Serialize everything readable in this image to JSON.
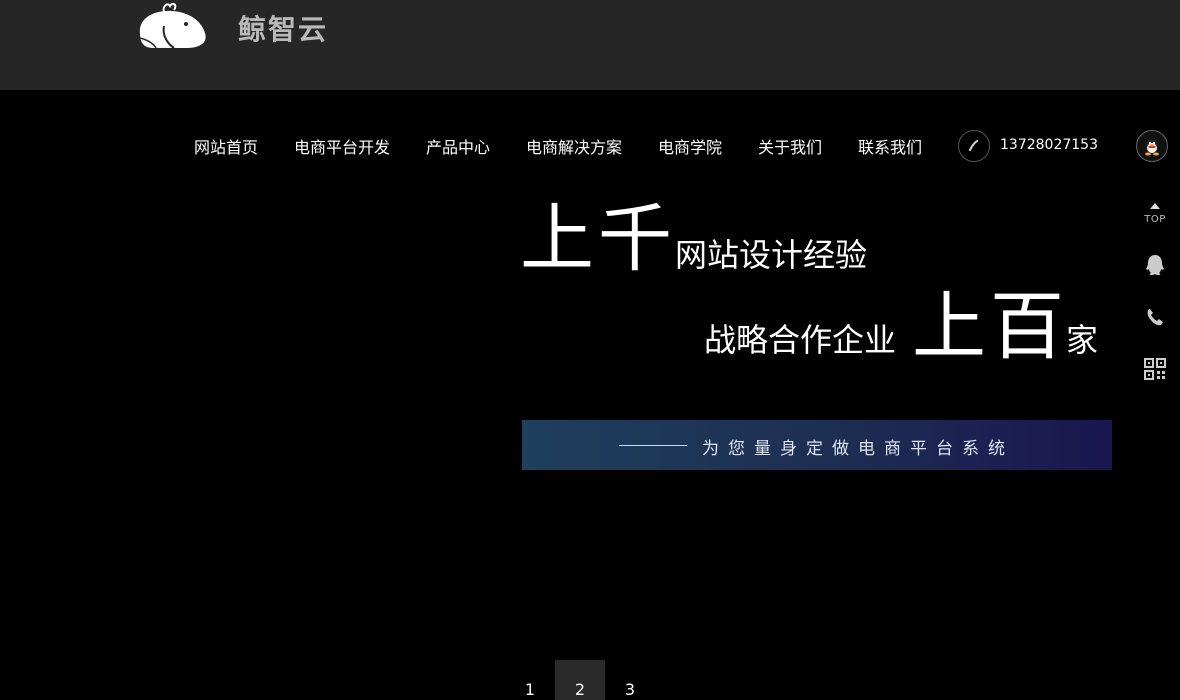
{
  "header": {
    "brand": "鲸智云"
  },
  "nav": {
    "items": [
      "网站首页",
      "电商平台开发",
      "产品中心",
      "电商解决方案",
      "电商学院",
      "关于我们",
      "联系我们"
    ],
    "phone": "13728027153"
  },
  "sidebar": {
    "top_label": "TOP"
  },
  "hero": {
    "big1": "上千",
    "text1": "网站设计经验",
    "text2": "战略合作企业",
    "big2": "上百",
    "text3": "家",
    "banner": "为您量身定做电商平台系统"
  },
  "pagination": {
    "pages": [
      "1",
      "2",
      "3"
    ],
    "active": "2"
  },
  "colors": {
    "header_bg": "#262626",
    "page_bg": "#000000",
    "banner_start": "#1f3f5c",
    "banner_end": "#1a1650"
  }
}
